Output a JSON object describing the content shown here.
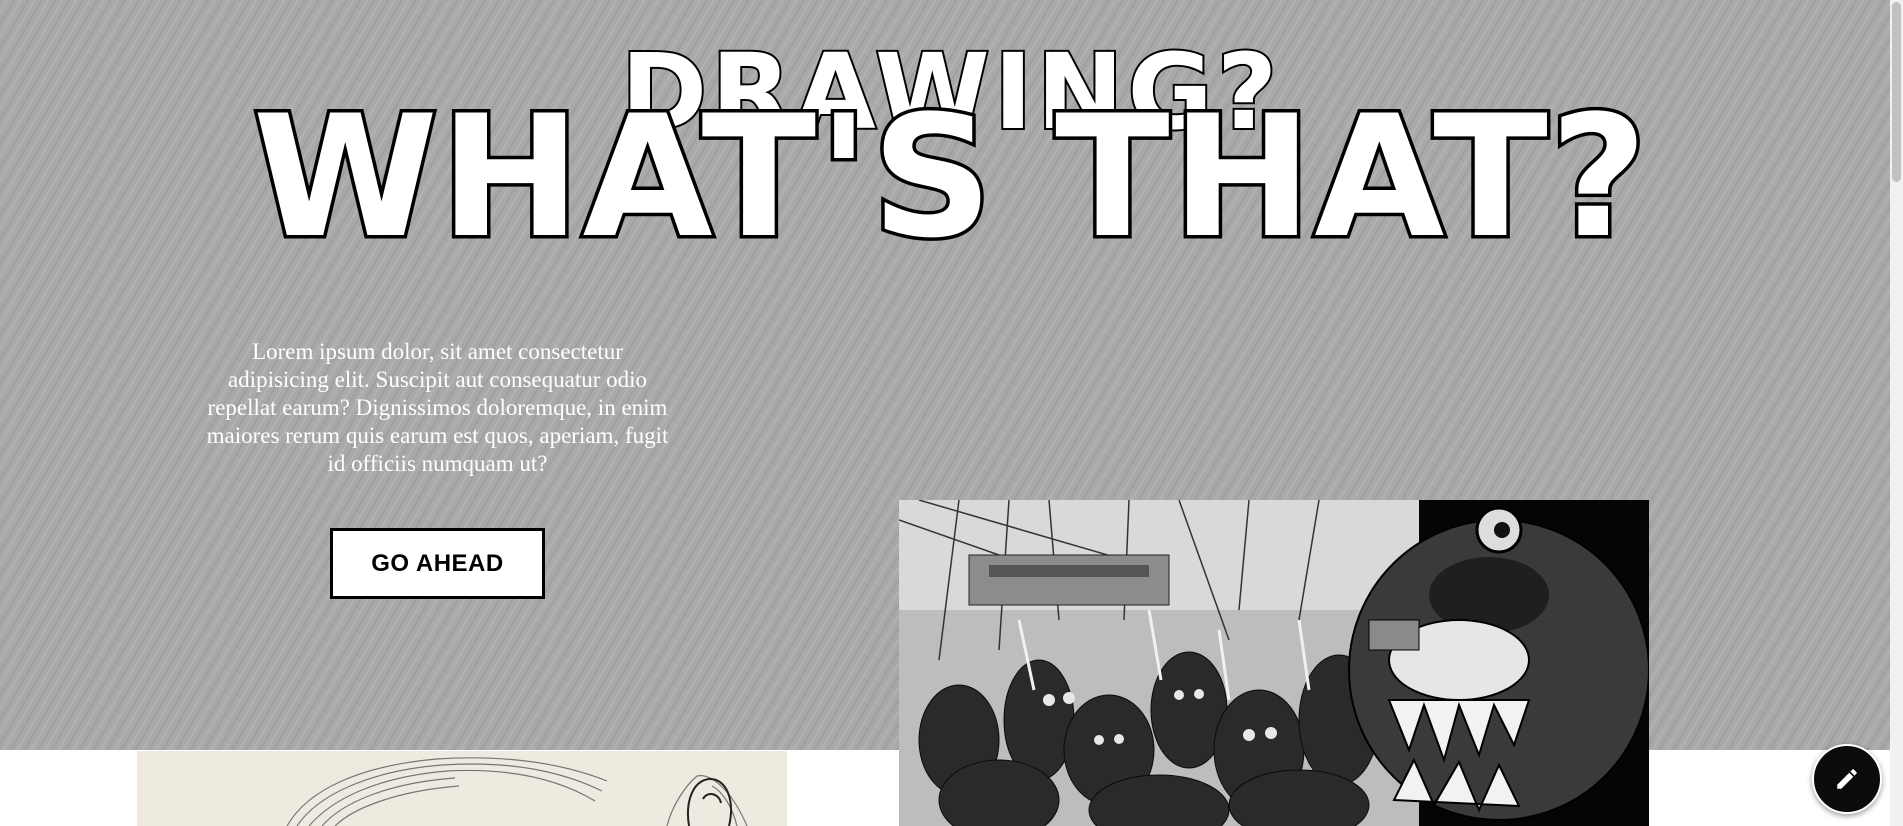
{
  "hero": {
    "title_top": "DRAWING?",
    "title_main": "WHAT'S THAT?",
    "description": "Lorem ipsum dolor, sit amet consectetur adipisicing elit. Suscipit aut consequatur odio repellat earum? Dignissimos doloremque, in enim maiores rerum quis earum est quos, aperiam, fugit id officiis numquam ut?",
    "cta_label": "GO AHEAD"
  },
  "gallery": {
    "images": [
      {
        "name": "pencil-sketch-portrait"
      },
      {
        "name": "ink-monster-horde"
      }
    ]
  },
  "fab": {
    "icon": "pencil-icon"
  },
  "colors": {
    "hero_bg": "#a9a9a9",
    "button_bg": "#ffffff",
    "button_border": "#000000",
    "fab_bg": "#0b0b0b"
  }
}
